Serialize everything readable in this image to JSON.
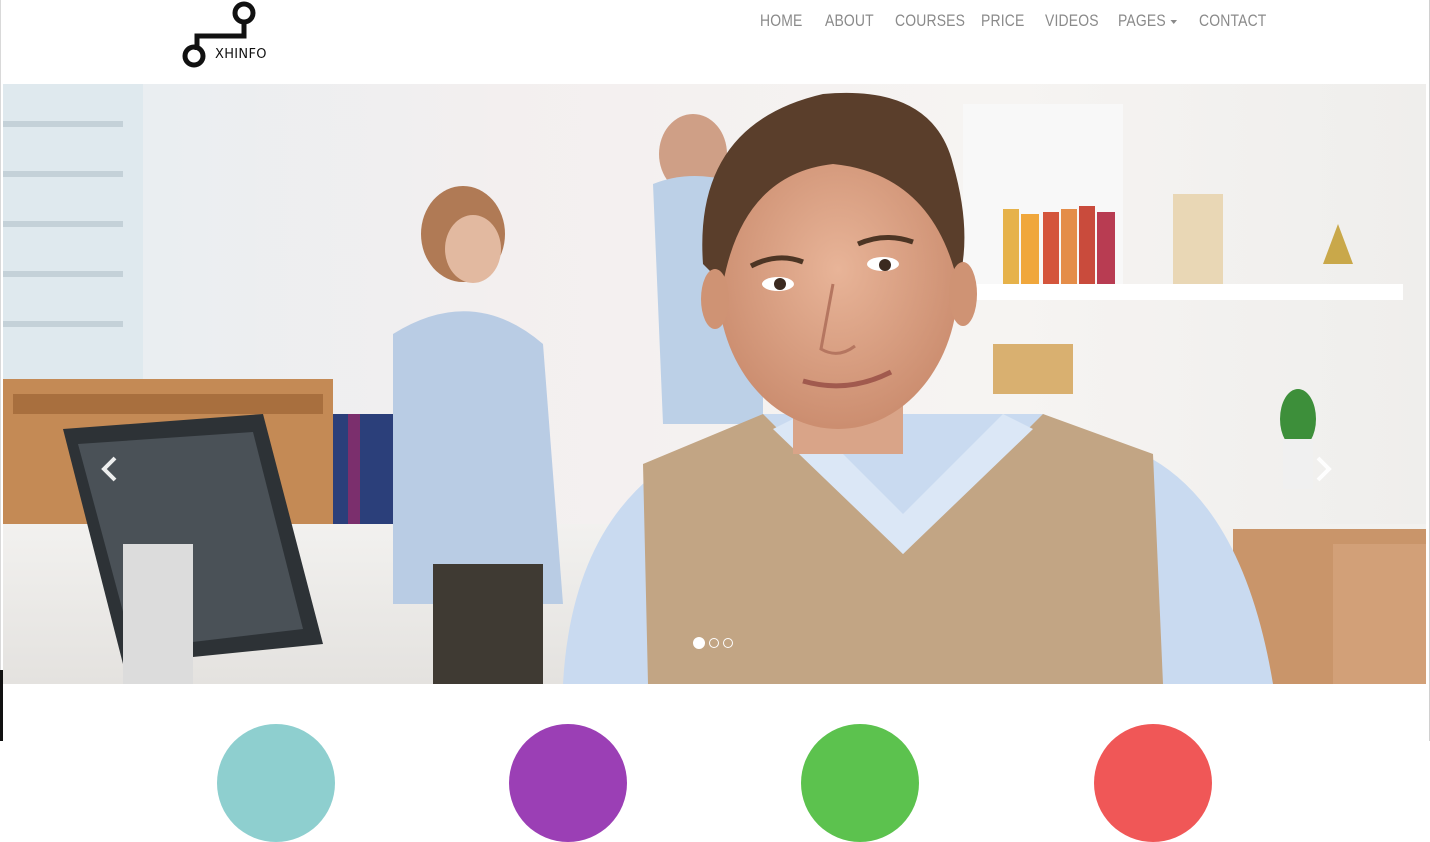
{
  "brand": {
    "name": "XHINFO",
    "logo_icon": "circuit-logo-icon"
  },
  "nav": {
    "items": [
      {
        "label": "HOME"
      },
      {
        "label": "ABOUT"
      },
      {
        "label": "COURSES"
      },
      {
        "label": "PRICE"
      },
      {
        "label": "VIDEOS"
      },
      {
        "label": "PAGES",
        "dropdown": true
      },
      {
        "label": "CONTACT"
      }
    ]
  },
  "carousel": {
    "slide_count": 3,
    "active_slide": 1,
    "prev_icon": "chevron-left-icon",
    "next_icon": "chevron-right-icon"
  },
  "features": {
    "circle_colors": [
      "#8ecfcf",
      "#9b3fb5",
      "#5cc24e",
      "#f05757"
    ]
  }
}
